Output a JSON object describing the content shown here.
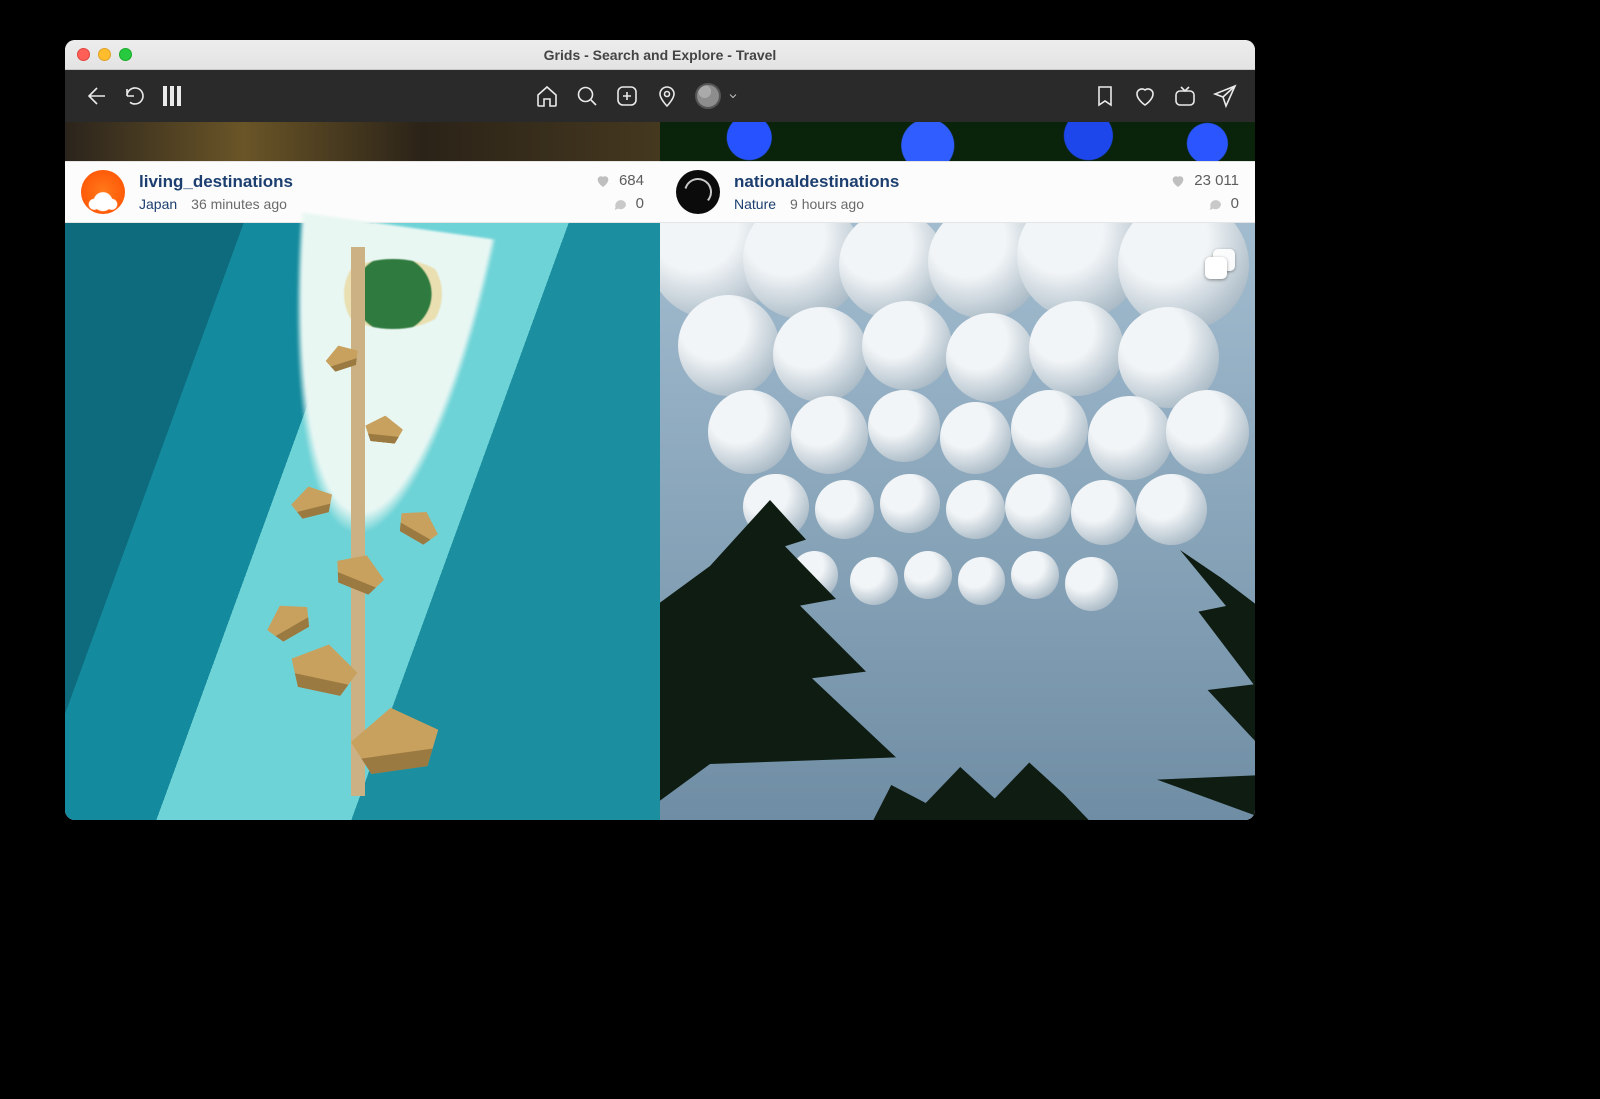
{
  "window": {
    "title": "Grids - Search and Explore - Travel"
  },
  "posts": [
    {
      "username": "living_destinations",
      "tag": "Japan",
      "time": "36 minutes ago",
      "likes": "684",
      "comments": "0"
    },
    {
      "username": "nationaldestinations",
      "tag": "Nature",
      "time": "9 hours ago",
      "likes": "23 011",
      "comments": "0"
    }
  ]
}
